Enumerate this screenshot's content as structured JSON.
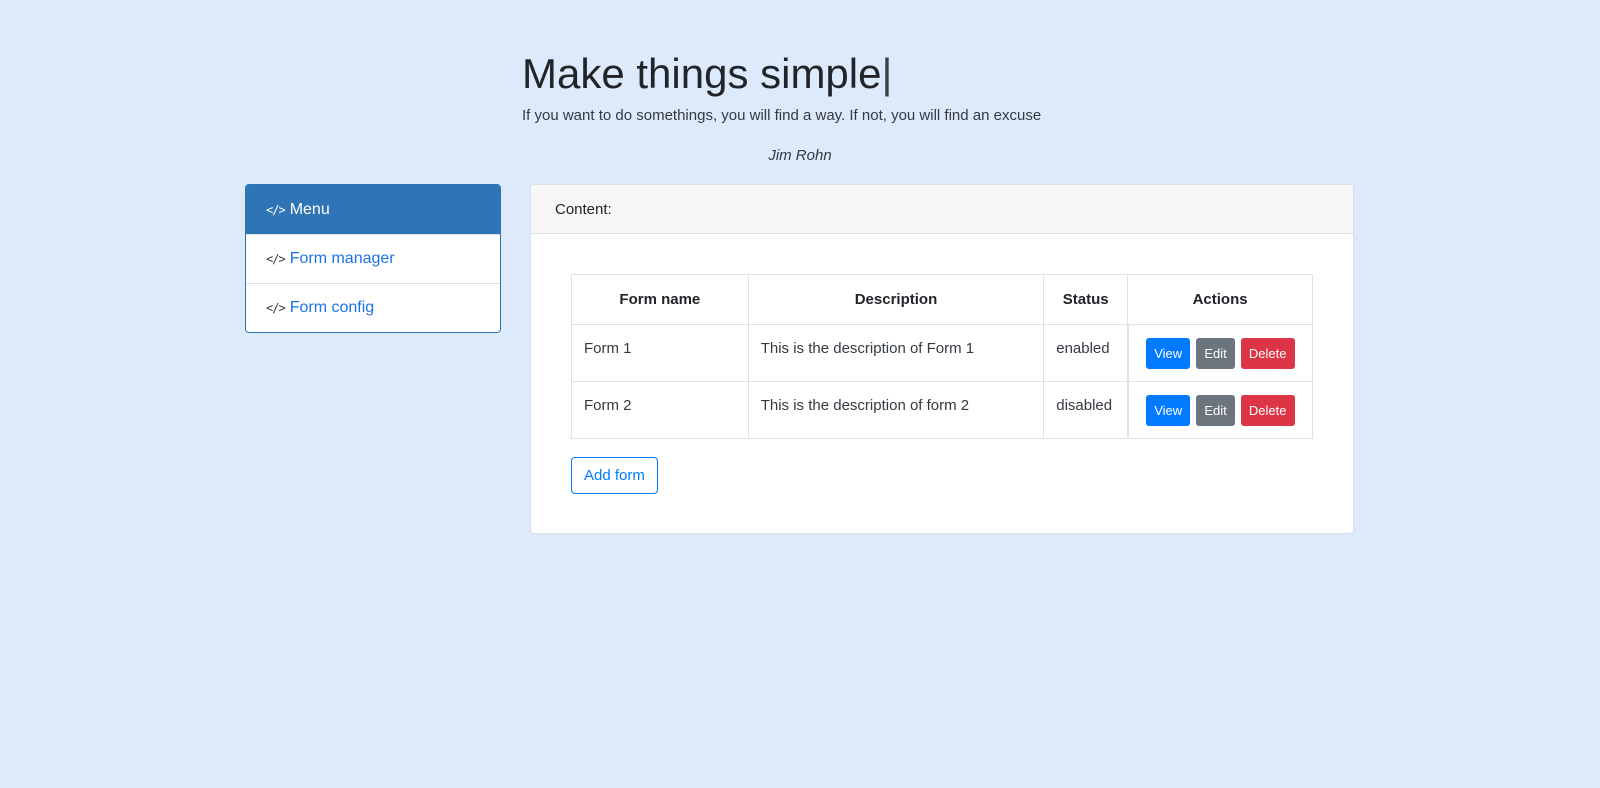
{
  "hero": {
    "title": "Make things simple",
    "cursor": "|",
    "subtitle": "If you want to do somethings, you will find a way. If not, you will find an excuse",
    "author": "Jim Rohn"
  },
  "menu": {
    "header_icon": "</>",
    "header": "Menu",
    "items": [
      {
        "icon": "</>",
        "label": "Form manager"
      },
      {
        "icon": "</>",
        "label": "Form config"
      }
    ]
  },
  "content": {
    "header": "Content:",
    "table": {
      "columns": [
        "Form name",
        "Description",
        "Status",
        "Actions"
      ],
      "rows": [
        {
          "name": "Form 1",
          "description": "This is the description of Form 1",
          "status": "enabled"
        },
        {
          "name": "Form 2",
          "description": "This is the description of form 2",
          "status": "disabled"
        }
      ],
      "actions": {
        "view": "View",
        "edit": "Edit",
        "delete": "Delete"
      }
    },
    "add_button": "Add form"
  },
  "colors": {
    "background": "#ddeafc",
    "menu_header": "#2f75b5",
    "link": "#1a73e8",
    "view": "#007bff",
    "edit": "#6c757d",
    "delete": "#dc3545"
  }
}
